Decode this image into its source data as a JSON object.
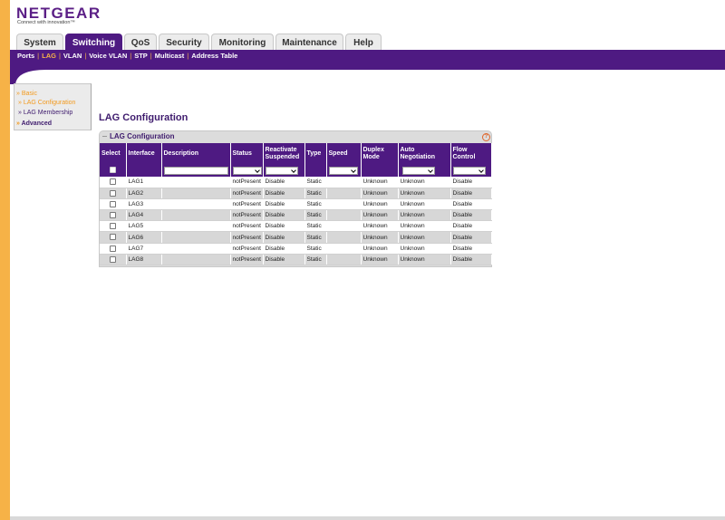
{
  "brand": {
    "logo": "NETGEAR",
    "tagline": "Connect with innovation™"
  },
  "tabs": [
    {
      "label": "System",
      "active": false
    },
    {
      "label": "Switching",
      "active": true
    },
    {
      "label": "QoS",
      "active": false
    },
    {
      "label": "Security",
      "active": false
    },
    {
      "label": "Monitoring",
      "active": false
    },
    {
      "label": "Maintenance",
      "active": false
    },
    {
      "label": "Help",
      "active": false
    }
  ],
  "subnav": [
    {
      "label": "Ports",
      "active": false
    },
    {
      "label": "LAG",
      "active": true
    },
    {
      "label": "VLAN",
      "active": false
    },
    {
      "label": "Voice VLAN",
      "active": false
    },
    {
      "label": "STP",
      "active": false
    },
    {
      "label": "Multicast",
      "active": false
    },
    {
      "label": "Address Table",
      "active": false
    }
  ],
  "sidebar": {
    "basic": "Basic",
    "items": [
      {
        "label": "LAG Configuration",
        "active": true
      },
      {
        "label": "LAG Membership",
        "active": false
      }
    ],
    "advanced": "Advanced"
  },
  "page": {
    "title": "LAG Configuration"
  },
  "box": {
    "title": "LAG Configuration",
    "help": "?"
  },
  "table": {
    "columns": [
      "Select",
      "Interface",
      "Description",
      "Status",
      "Reactivate Suspended",
      "Type",
      "Speed",
      "Duplex Mode",
      "Auto Negotiation",
      "Flow Control"
    ],
    "rows": [
      {
        "interface": "LAG1",
        "status": "notPresent",
        "reactivate": "Disable",
        "type": "Static",
        "speed": "",
        "duplex": "Unknown",
        "auto": "Unknown",
        "flow": "Disable"
      },
      {
        "interface": "LAG2",
        "status": "notPresent",
        "reactivate": "Disable",
        "type": "Static",
        "speed": "",
        "duplex": "Unknown",
        "auto": "Unknown",
        "flow": "Disable"
      },
      {
        "interface": "LAG3",
        "status": "notPresent",
        "reactivate": "Disable",
        "type": "Static",
        "speed": "",
        "duplex": "Unknown",
        "auto": "Unknown",
        "flow": "Disable"
      },
      {
        "interface": "LAG4",
        "status": "notPresent",
        "reactivate": "Disable",
        "type": "Static",
        "speed": "",
        "duplex": "Unknown",
        "auto": "Unknown",
        "flow": "Disable"
      },
      {
        "interface": "LAG5",
        "status": "notPresent",
        "reactivate": "Disable",
        "type": "Static",
        "speed": "",
        "duplex": "Unknown",
        "auto": "Unknown",
        "flow": "Disable"
      },
      {
        "interface": "LAG6",
        "status": "notPresent",
        "reactivate": "Disable",
        "type": "Static",
        "speed": "",
        "duplex": "Unknown",
        "auto": "Unknown",
        "flow": "Disable"
      },
      {
        "interface": "LAG7",
        "status": "notPresent",
        "reactivate": "Disable",
        "type": "Static",
        "speed": "",
        "duplex": "Unknown",
        "auto": "Unknown",
        "flow": "Disable"
      },
      {
        "interface": "LAG8",
        "status": "notPresent",
        "reactivate": "Disable",
        "type": "Static",
        "speed": "",
        "duplex": "Unknown",
        "auto": "Unknown",
        "flow": "Disable"
      }
    ]
  },
  "colors": {
    "purple": "#4e1a82",
    "orange": "#f6b247",
    "accent_text": "#f39a1e",
    "gray_row": "#d7d7d7"
  }
}
